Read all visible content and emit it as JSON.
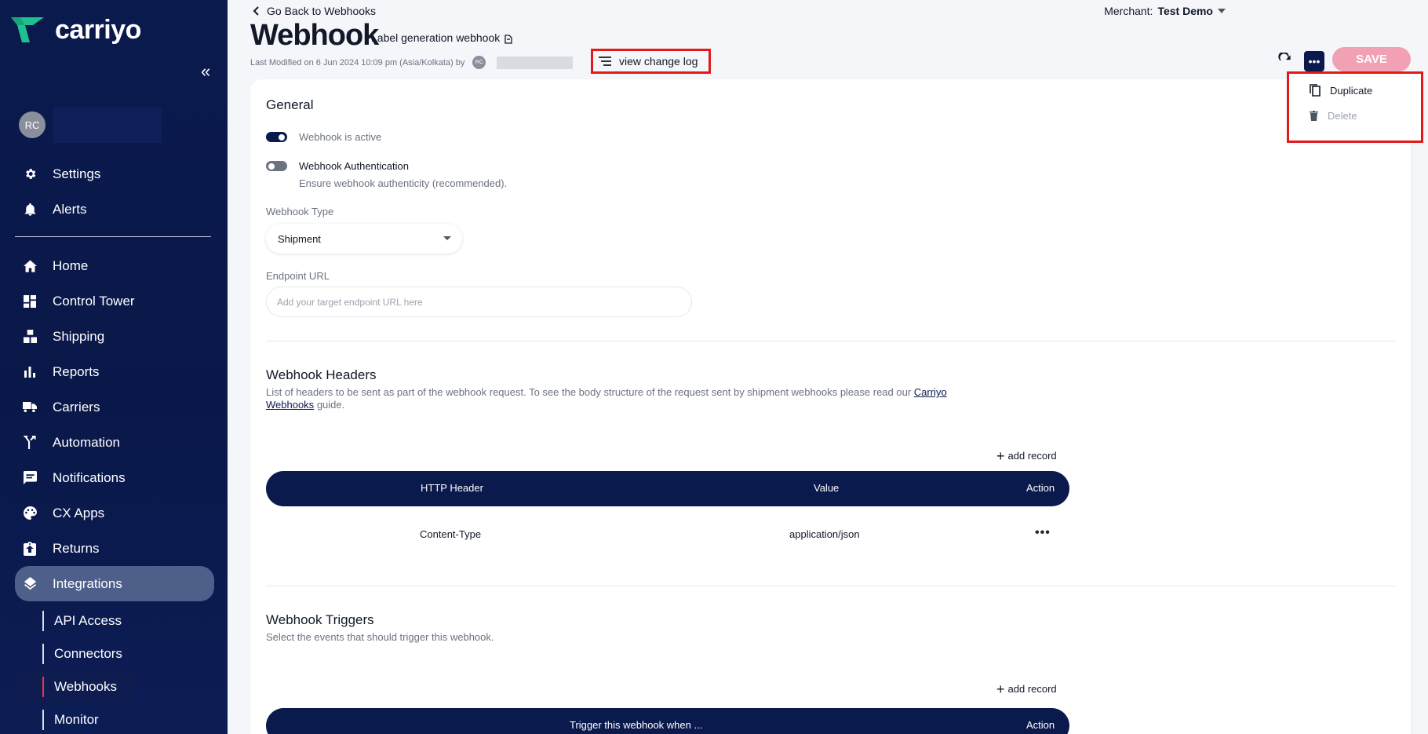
{
  "sidebar": {
    "logo_text": "carriyo",
    "user_initials": "RC",
    "top_items": [
      {
        "label": "Settings",
        "icon": "gear-icon"
      },
      {
        "label": "Alerts",
        "icon": "bell-icon"
      }
    ],
    "items": [
      {
        "label": "Home",
        "icon": "home-icon"
      },
      {
        "label": "Control Tower",
        "icon": "dashboard-icon"
      },
      {
        "label": "Shipping",
        "icon": "boxes-icon"
      },
      {
        "label": "Reports",
        "icon": "bar-chart-icon"
      },
      {
        "label": "Carriers",
        "icon": "truck-icon"
      },
      {
        "label": "Automation",
        "icon": "fork-icon"
      },
      {
        "label": "Notifications",
        "icon": "message-icon"
      },
      {
        "label": "CX Apps",
        "icon": "palette-icon"
      },
      {
        "label": "Returns",
        "icon": "return-icon"
      },
      {
        "label": "Integrations",
        "icon": "layers-icon"
      }
    ],
    "sub_items": [
      {
        "label": "API Access"
      },
      {
        "label": "Connectors"
      },
      {
        "label": "Webhooks"
      },
      {
        "label": "Monitor"
      }
    ]
  },
  "header": {
    "back_label": "Go Back to Webhooks",
    "merchant_label": "Merchant:",
    "merchant_value": "Test Demo",
    "title": "Webhook",
    "subtitle": "Label generation webhook",
    "last_modified": "Last Modified on 6 Jun 2024 10:09 pm (Asia/Kolkata) by",
    "modifier_initials": "RC",
    "changelog_label": "view change log",
    "save_label": "SAVE"
  },
  "dropdown": {
    "items": [
      {
        "label": "Duplicate",
        "icon": "copy-icon"
      },
      {
        "label": "Delete",
        "icon": "trash-icon"
      }
    ]
  },
  "general": {
    "title": "General",
    "active_label": "Webhook is active",
    "active_on": true,
    "auth_label": "Webhook Authentication",
    "auth_on": false,
    "auth_help": "Ensure webhook authenticity (recommended).",
    "type_label": "Webhook Type",
    "type_value": "Shipment",
    "endpoint_label": "Endpoint URL",
    "endpoint_placeholder": "Add your target endpoint URL here",
    "endpoint_value": ""
  },
  "headers": {
    "title": "Webhook Headers",
    "desc_prefix": "List of headers to be sent as part of the webhook request. To see the body structure of the request sent by shipment webhooks please read our",
    "desc_link_1": "Carriyo",
    "desc_link_2": "Webhooks",
    "desc_suffix": "guide.",
    "add_label": "add record",
    "columns": [
      "HTTP Header",
      "Value",
      "Action"
    ],
    "rows": [
      {
        "header": "Content-Type",
        "value": "application/json"
      }
    ]
  },
  "triggers": {
    "title": "Webhook Triggers",
    "desc": "Select the events that should trigger this webhook.",
    "add_label": "add record",
    "columns": [
      "Trigger this webhook when ...",
      "Action"
    ]
  },
  "colors": {
    "navy": "#0b1a4d",
    "accent_green": "#1fbf8f",
    "save_pink": "#f2a0b3",
    "highlight_red": "#e21a1a"
  }
}
